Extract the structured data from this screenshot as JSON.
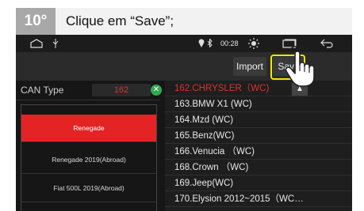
{
  "step": {
    "number": "10°",
    "instruction": "Clique em “Save”;"
  },
  "status_bar": {
    "time": "00:28",
    "home_icon": "home-outline-icon",
    "usb_icon": "usb-icon",
    "location_icon": "location-pin-icon",
    "bluetooth_icon": "bluetooth-icon",
    "brightness_icon": "brightness-icon",
    "window_icon": "recent-apps-icon",
    "back_icon": "back-arrow-icon"
  },
  "toolbar": {
    "import_label": "Import",
    "save_label": "Save"
  },
  "left_panel": {
    "can_type_label": "CAN Type",
    "can_type_value": "162",
    "vehicles": [
      {
        "label": "Renegade",
        "selected": true
      },
      {
        "label": "Renegade 2019(Abroad)",
        "selected": false
      },
      {
        "label": "Fiat 500L 2019(Abroad)",
        "selected": false
      }
    ]
  },
  "right_panel": {
    "items": [
      {
        "label": "162.CHRYSLER（WC)",
        "selected": true
      },
      {
        "label": "163.BMW X1  (WC)",
        "selected": false
      },
      {
        "label": "164.Mzd (WC)",
        "selected": false
      },
      {
        "label": "165.Benz(WC)",
        "selected": false
      },
      {
        "label": "166.Venucia （WC)",
        "selected": false
      },
      {
        "label": "168.Crown （WC)",
        "selected": false
      },
      {
        "label": "169.Jeep(WC)",
        "selected": false
      },
      {
        "label": "170.Elysion 2012~2015（WC…",
        "selected": false
      }
    ]
  },
  "colors": {
    "accent_red": "#e42424",
    "highlight_yellow": "#f2e600",
    "check_green": "#2fa84f"
  }
}
